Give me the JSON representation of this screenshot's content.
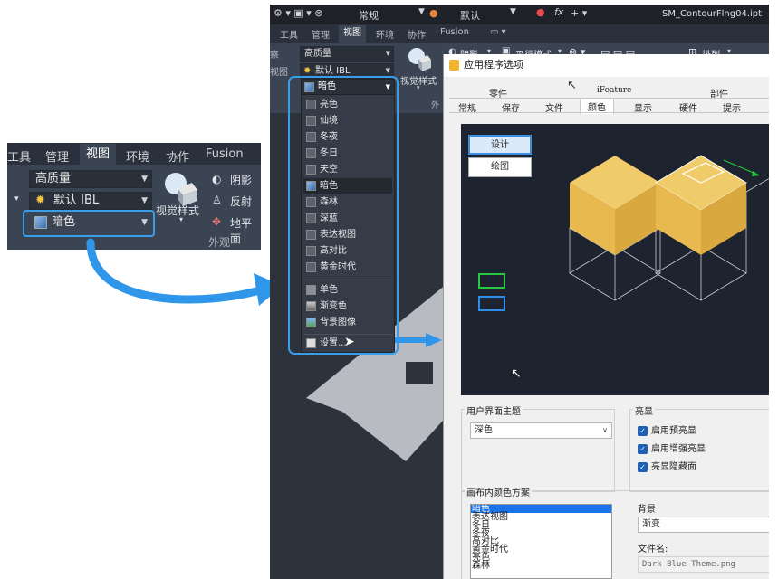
{
  "left_crop": {
    "tabs": [
      "工具",
      "管理",
      "视图",
      "环境",
      "协作",
      "Fusion"
    ],
    "active_tab": "视图",
    "quality": "高质量",
    "ibl": "默认 IBL",
    "color_scheme": "暗色",
    "visual_style": "视觉样式",
    "shadow": "阴影",
    "reflection": "反射",
    "ground": "地平面",
    "group_label": "外观"
  },
  "app": {
    "document_title": "SM_ContourFlng04.ipt",
    "qat": {
      "material": "常规",
      "appearance": "默认",
      "fx": "fx"
    },
    "tabs": [
      "工具",
      "管理",
      "视图",
      "环境",
      "协作",
      "Fusion"
    ],
    "active_tab": "视图",
    "ribbon": {
      "quality": "高质量",
      "ibl": "默认 IBL",
      "visual_style": "视觉样式",
      "shadow": "阴影",
      "ortho": "平行模式",
      "arrange": "排列",
      "left_stub_1": "察",
      "left_stub_2": "视图",
      "group_stub": "外"
    }
  },
  "dropdown": {
    "current": "暗色",
    "items": [
      "亮色",
      "仙境",
      "冬夜",
      "冬日",
      "天空",
      "暗色",
      "森林",
      "深蓝",
      "表达视图",
      "高对比",
      "黄金时代"
    ],
    "selected_index": 5,
    "bg_items": [
      "单色",
      "渐变色",
      "背景图像"
    ],
    "settings": "设置..."
  },
  "dialog": {
    "title": "应用程序选项",
    "tabs_row1": [
      "零件",
      "iFeature",
      "部件"
    ],
    "tabs_row2": [
      "常规",
      "保存",
      "文件",
      "颜色",
      "显示",
      "硬件",
      "提示"
    ],
    "active_tab": "颜色",
    "preview_buttons": {
      "design": "设计",
      "drawing": "绘图"
    },
    "ui_theme": {
      "label": "用户界面主题",
      "value": "深色"
    },
    "highlight": {
      "label": "亮显",
      "options": [
        "启用预亮显",
        "启用增强亮显",
        "亮显隐藏面"
      ]
    },
    "canvas_scheme": {
      "label": "画布内颜色方案",
      "items": [
        "暗色",
        "表达视图",
        "冬日",
        "冬夜",
        "高对比",
        "黄金时代",
        "亮色",
        "森林"
      ],
      "selected_index": 0
    },
    "background": {
      "label": "背景",
      "value": "渐变"
    },
    "file_name": {
      "label": "文件名:",
      "value": "Dark Blue Theme.png"
    }
  },
  "colors": {
    "ribbon": "#3b4453",
    "tabs_bar": "#2b313c",
    "accent_blue": "#3a9de9",
    "cube_yellow": "#e8b94f",
    "preview_bg": "#1e2330"
  }
}
